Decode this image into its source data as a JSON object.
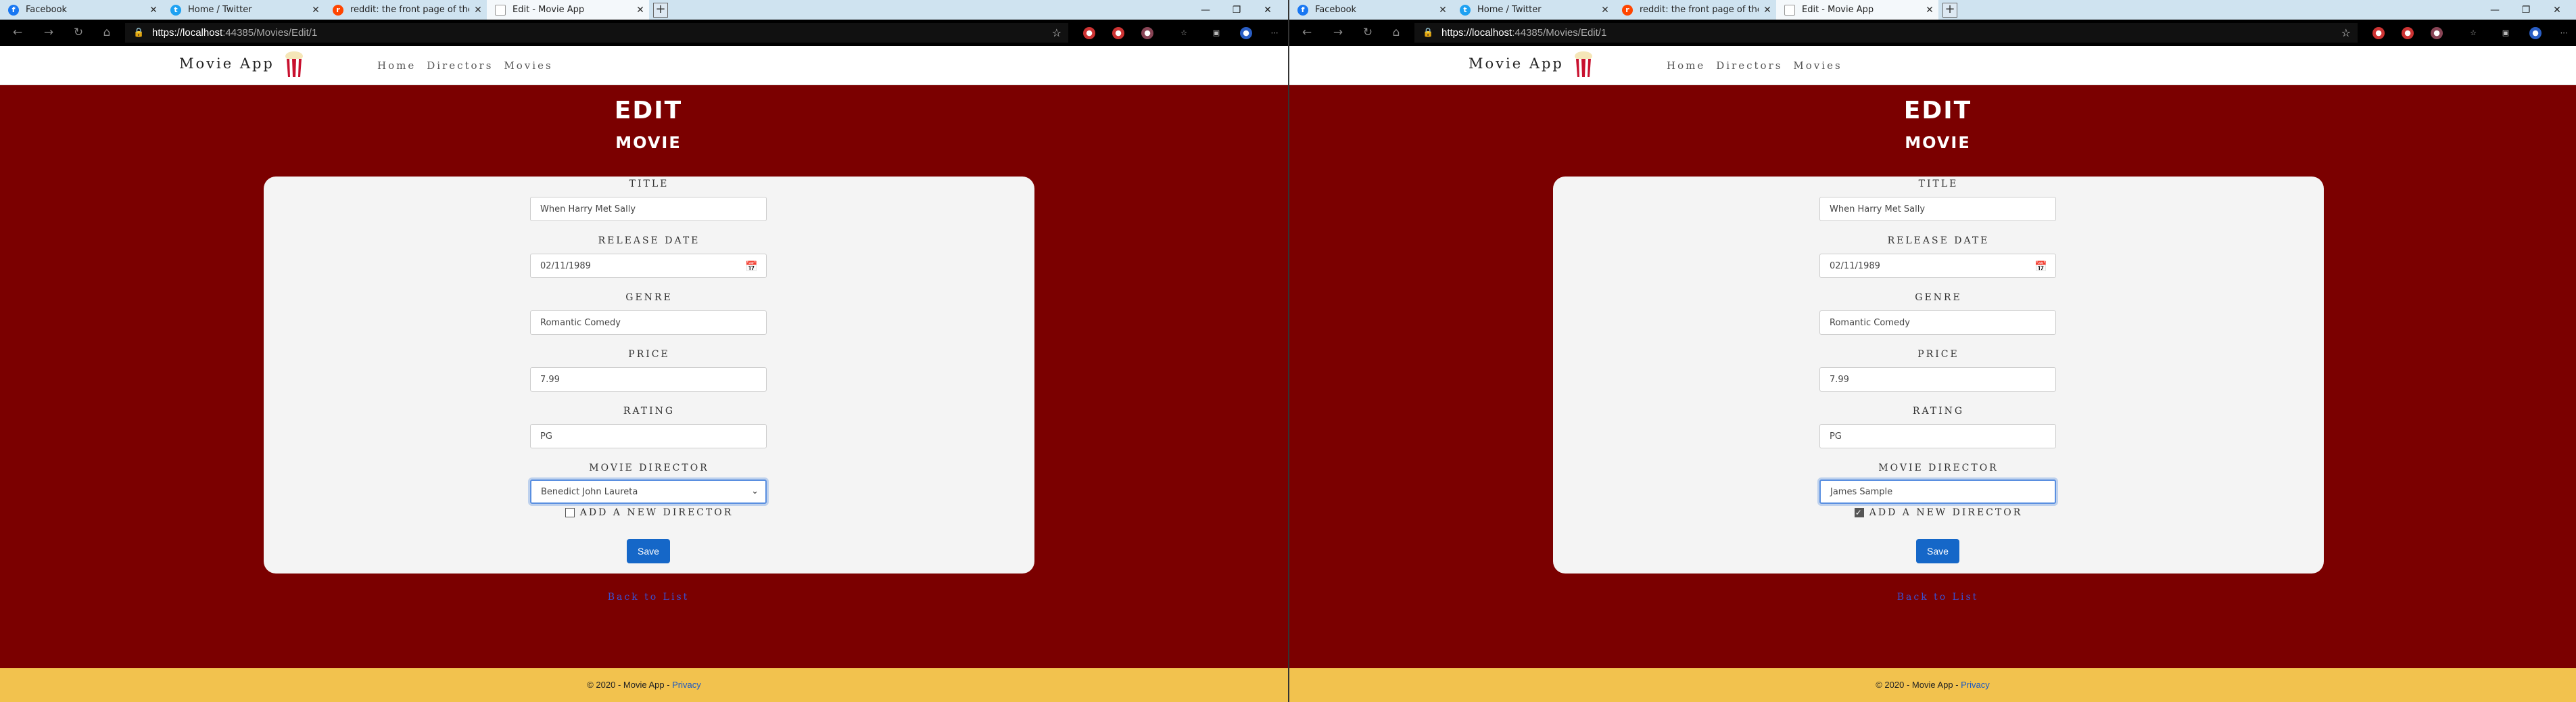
{
  "browser": {
    "tabs": [
      {
        "label": "Facebook",
        "icon": "facebook-icon",
        "color": "#1877f2"
      },
      {
        "label": "Home / Twitter",
        "icon": "twitter-icon",
        "color": "#1da1f2"
      },
      {
        "label": "reddit: the front page of the inte",
        "icon": "reddit-icon",
        "color": "#ff4500"
      },
      {
        "label": "Edit - Movie App",
        "icon": "page-icon",
        "color": "#ffffff"
      }
    ],
    "url_host": "https://localhost",
    "url_rest": ":44385/Movies/Edit/1"
  },
  "site": {
    "brand": "Movie App",
    "nav": [
      "Home",
      "Directors",
      "Movies"
    ],
    "heading": "EDIT",
    "subheading": "MOVIE",
    "labels": {
      "title": "TITLE",
      "release_date": "RELEASE DATE",
      "genre": "GENRE",
      "price": "PRICE",
      "rating": "RATING",
      "director": "MOVIE DIRECTOR",
      "add_director": "ADD A NEW DIRECTOR"
    },
    "save_label": "Save",
    "back_label": "Back to List",
    "footer_text": "© 2020 - Movie App - ",
    "footer_link": "Privacy"
  },
  "left_form": {
    "title": "When Harry Met Sally",
    "release_date": "02/11/1989",
    "genre": "Romantic Comedy",
    "price": "7.99",
    "rating": "PG",
    "director": "Benedict John Laureta",
    "add_new_checked": false
  },
  "right_form": {
    "title": "When Harry Met Sally",
    "release_date": "02/11/1989",
    "genre": "Romantic Comedy",
    "price": "7.99",
    "rating": "PG",
    "director": "James Sample",
    "add_new_checked": true
  }
}
